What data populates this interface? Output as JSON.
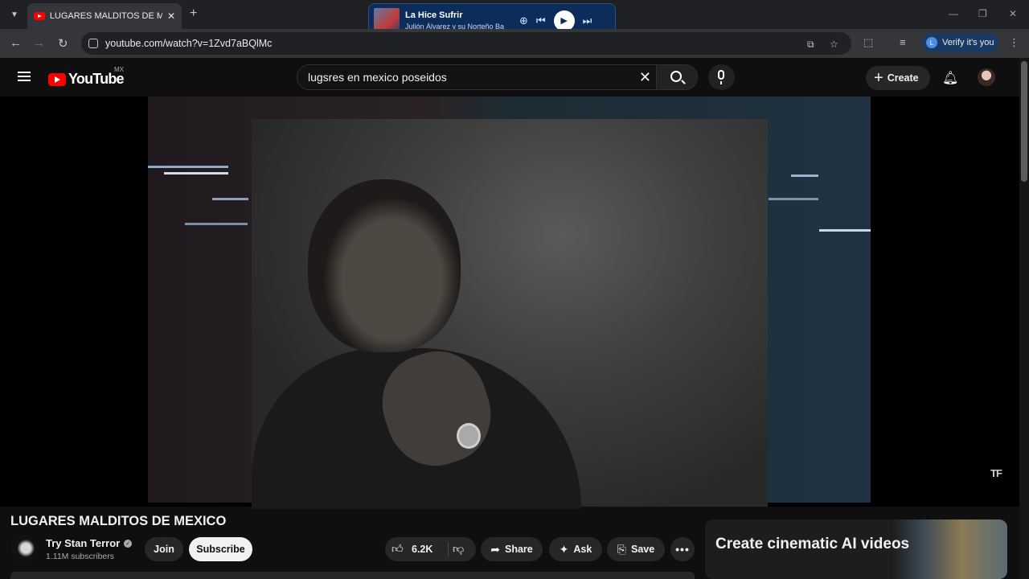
{
  "browser": {
    "tab_title": "LUGARES MALDITOS DE MEXICO",
    "url": "youtube.com/watch?v=1Zvd7aBQlMc",
    "verify_label": "Verify it's you"
  },
  "media": {
    "song": "La Hice Sufrir",
    "artist": "Julión Álvarez y su Norteño Ba"
  },
  "youtube": {
    "logo_text": "YouTube",
    "country": "MX",
    "search_value": "lugsres en mexico poseidos",
    "create_label": "Create"
  },
  "video": {
    "watermark": "TF",
    "title": "LUGARES MALDITOS DE MEXICO",
    "channel": "Try Stan Terror",
    "subscribers": "1.11M subscribers",
    "join_label": "Join",
    "subscribe_label": "Subscribe",
    "likes": "6.2K",
    "share_label": "Share",
    "ask_label": "Ask",
    "save_label": "Save"
  },
  "ad": {
    "text": "Create cinematic AI videos"
  },
  "colors": {
    "brand_red": "#ff0000",
    "background": "#0f0f0f",
    "pill": "#272727"
  }
}
